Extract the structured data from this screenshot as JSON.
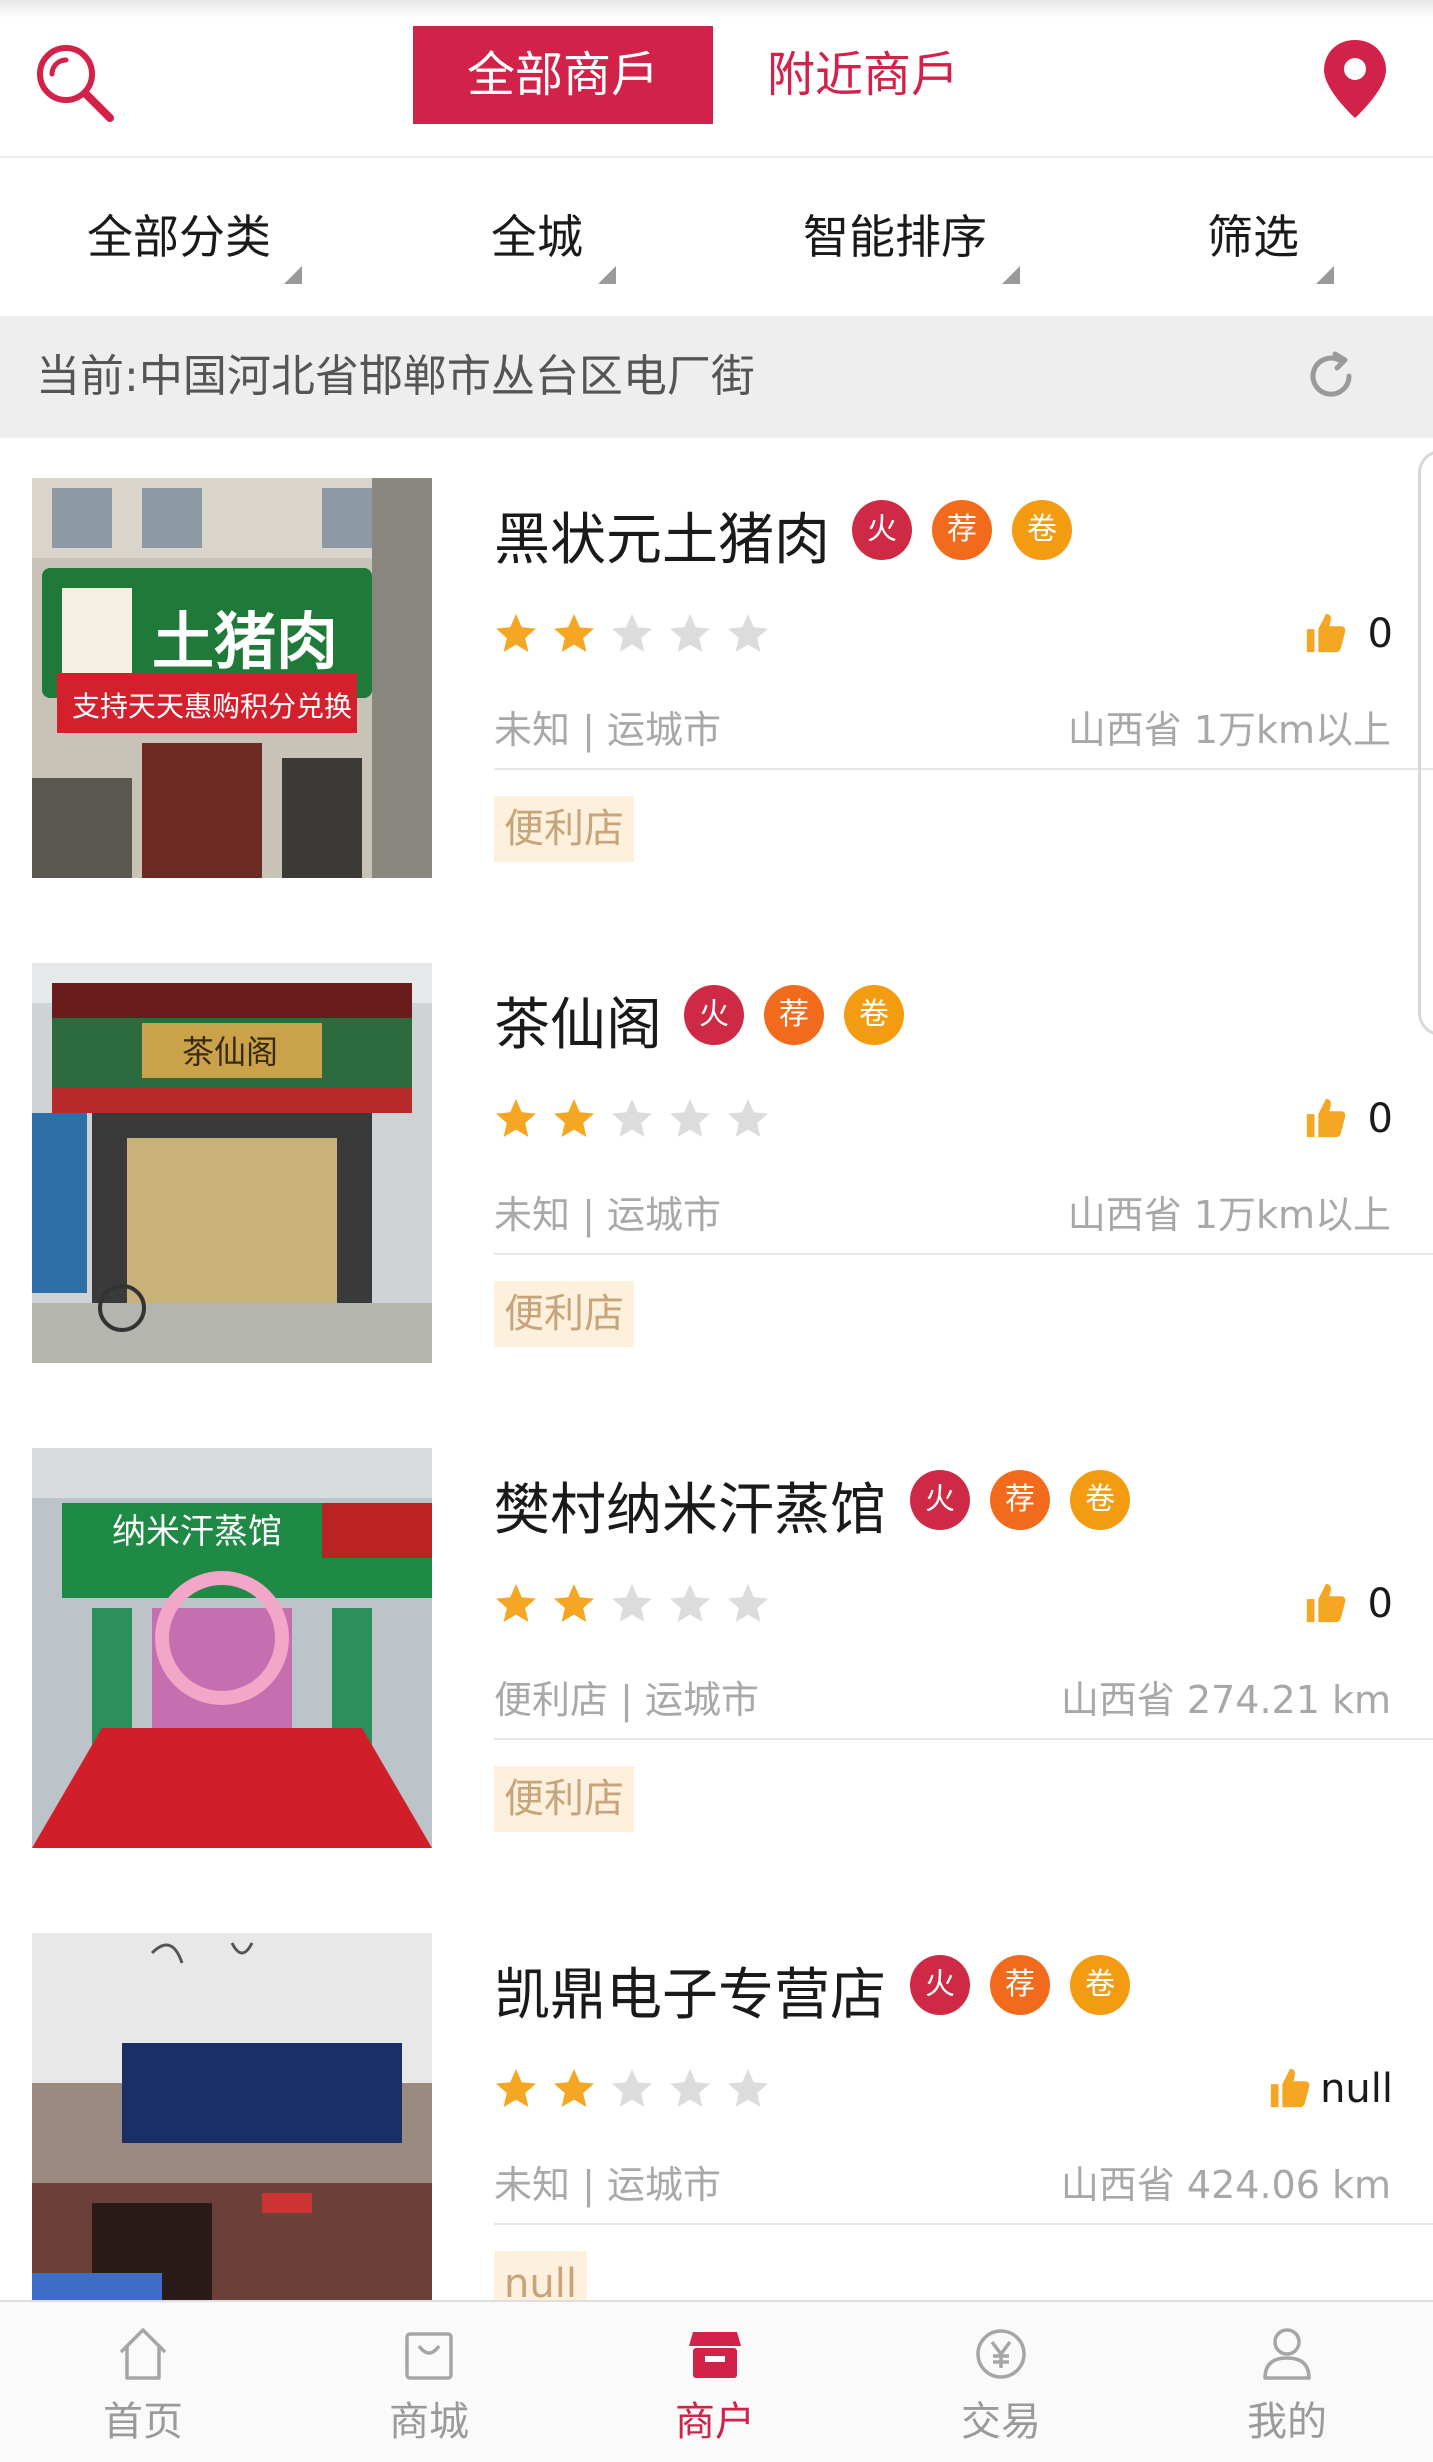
{
  "header": {
    "tabs": [
      {
        "label": "全部商戶",
        "active": true
      },
      {
        "label": "附近商戶",
        "active": false
      }
    ],
    "icons": {
      "search": "search-icon",
      "location": "location-pin-icon"
    }
  },
  "filters": [
    {
      "label": "全部分类"
    },
    {
      "label": "全城"
    },
    {
      "label": "智能排序"
    },
    {
      "label": "筛选"
    }
  ],
  "location": {
    "text": "当前:中国河北省邯郸市丛台区电厂街"
  },
  "badge_labels": {
    "fire": "火",
    "recommend": "荐",
    "coupon": "卷"
  },
  "merchants": [
    {
      "name": "黑状元土猪肉",
      "rating": 2,
      "likes": "0",
      "category_city": "未知 | 运城市",
      "province_distance": "山西省  1万km以上",
      "tag": "便利店"
    },
    {
      "name": "茶仙阁",
      "rating": 2,
      "likes": "0",
      "category_city": "未知 | 运城市",
      "province_distance": "山西省  1万km以上",
      "tag": "便利店"
    },
    {
      "name": "樊村纳米汗蒸馆",
      "rating": 2,
      "likes": "0",
      "category_city": "便利店 | 运城市",
      "province_distance": "山西省  274.21 km",
      "tag": "便利店"
    },
    {
      "name": "凯鼎电子专营店",
      "rating": 2,
      "likes": "null",
      "category_city": "未知 | 运城市",
      "province_distance": "山西省  424.06 km",
      "tag": "null"
    }
  ],
  "storefront_signs": [
    "土猪肉",
    "支持天天惠购积分兑换",
    "茶仙阁",
    "纳米汗蒸馆"
  ],
  "bottom_nav": [
    {
      "label": "首页",
      "icon": "home-icon",
      "active": false
    },
    {
      "label": "商城",
      "icon": "shopping-bag-icon",
      "active": false
    },
    {
      "label": "商户",
      "icon": "store-icon",
      "active": true
    },
    {
      "label": "交易",
      "icon": "yuan-coin-icon",
      "active": false
    },
    {
      "label": "我的",
      "icon": "user-icon",
      "active": false
    }
  ],
  "colors": {
    "accent": "#d2224a",
    "star": "#f5a623",
    "tag_bg": "#fdf0dc",
    "tag_text": "#c7a47a"
  }
}
